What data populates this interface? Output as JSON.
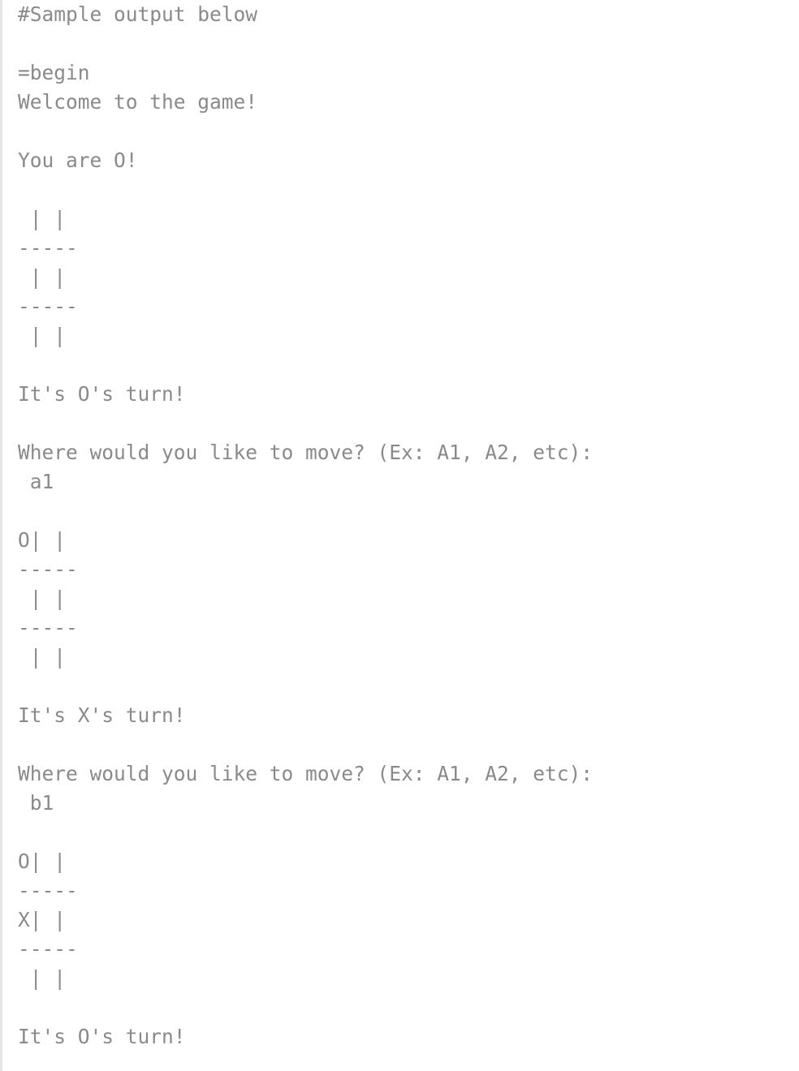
{
  "code_view": {
    "lines": [
      "#Sample output below",
      "",
      "=begin",
      "Welcome to the game!",
      "",
      "You are O!",
      "",
      " | |",
      "-----",
      " | |",
      "-----",
      " | |",
      "",
      "It's O's turn!",
      "",
      "Where would you like to move? (Ex: A1, A2, etc):",
      " a1",
      "",
      "O| |",
      "-----",
      " | |",
      "-----",
      " | |",
      "",
      "It's X's turn!",
      "",
      "Where would you like to move? (Ex: A1, A2, etc):",
      " b1",
      "",
      "O| |",
      "-----",
      "X| |",
      "-----",
      " | |",
      "",
      "It's O's turn!"
    ]
  }
}
